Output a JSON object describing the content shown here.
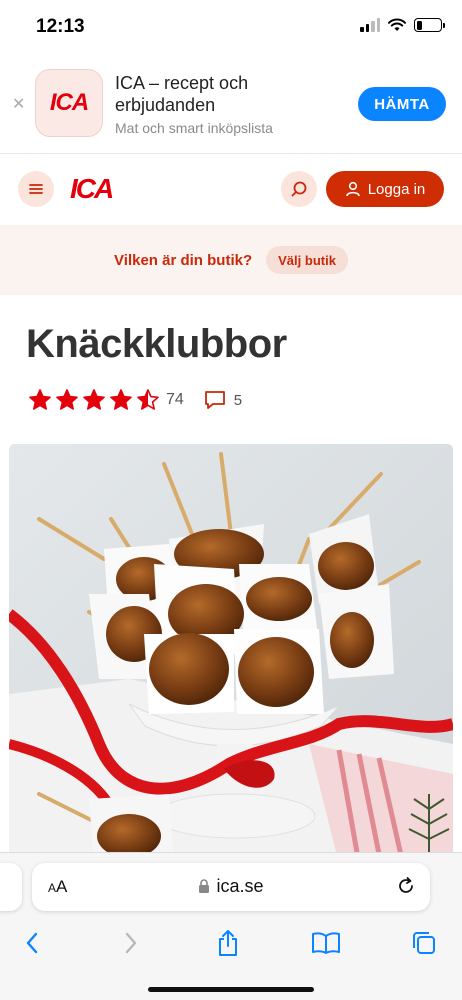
{
  "status_bar": {
    "time": "12:13",
    "battery_level": 0.25
  },
  "app_banner": {
    "app_name": "ICA – recept och erbjudanden",
    "subtitle": "Mat och smart inköpslista",
    "get_label": "HÄMTA",
    "icon_text": "ICA"
  },
  "header": {
    "logo": "ICA",
    "login_label": "Logga in"
  },
  "store_bar": {
    "question": "Vilken är din butik?",
    "button_label": "Välj butik"
  },
  "recipe": {
    "title": "Knäckklubbor",
    "rating": 4.5,
    "rating_count": "74",
    "comment_count": "5"
  },
  "browser": {
    "text_size_label": "AA",
    "domain": "ica.se"
  },
  "colors": {
    "brand_red": "#e3000b",
    "button_orange": "#cf2e05",
    "star_red": "#e3000b",
    "link_blue": "#0a84ff"
  },
  "icons": [
    "close-icon",
    "menu-icon",
    "search-icon",
    "user-icon",
    "star-icon",
    "comment-icon",
    "lock-icon",
    "reload-icon",
    "back-icon",
    "forward-icon",
    "share-icon",
    "bookmarks-icon",
    "tabs-icon"
  ]
}
